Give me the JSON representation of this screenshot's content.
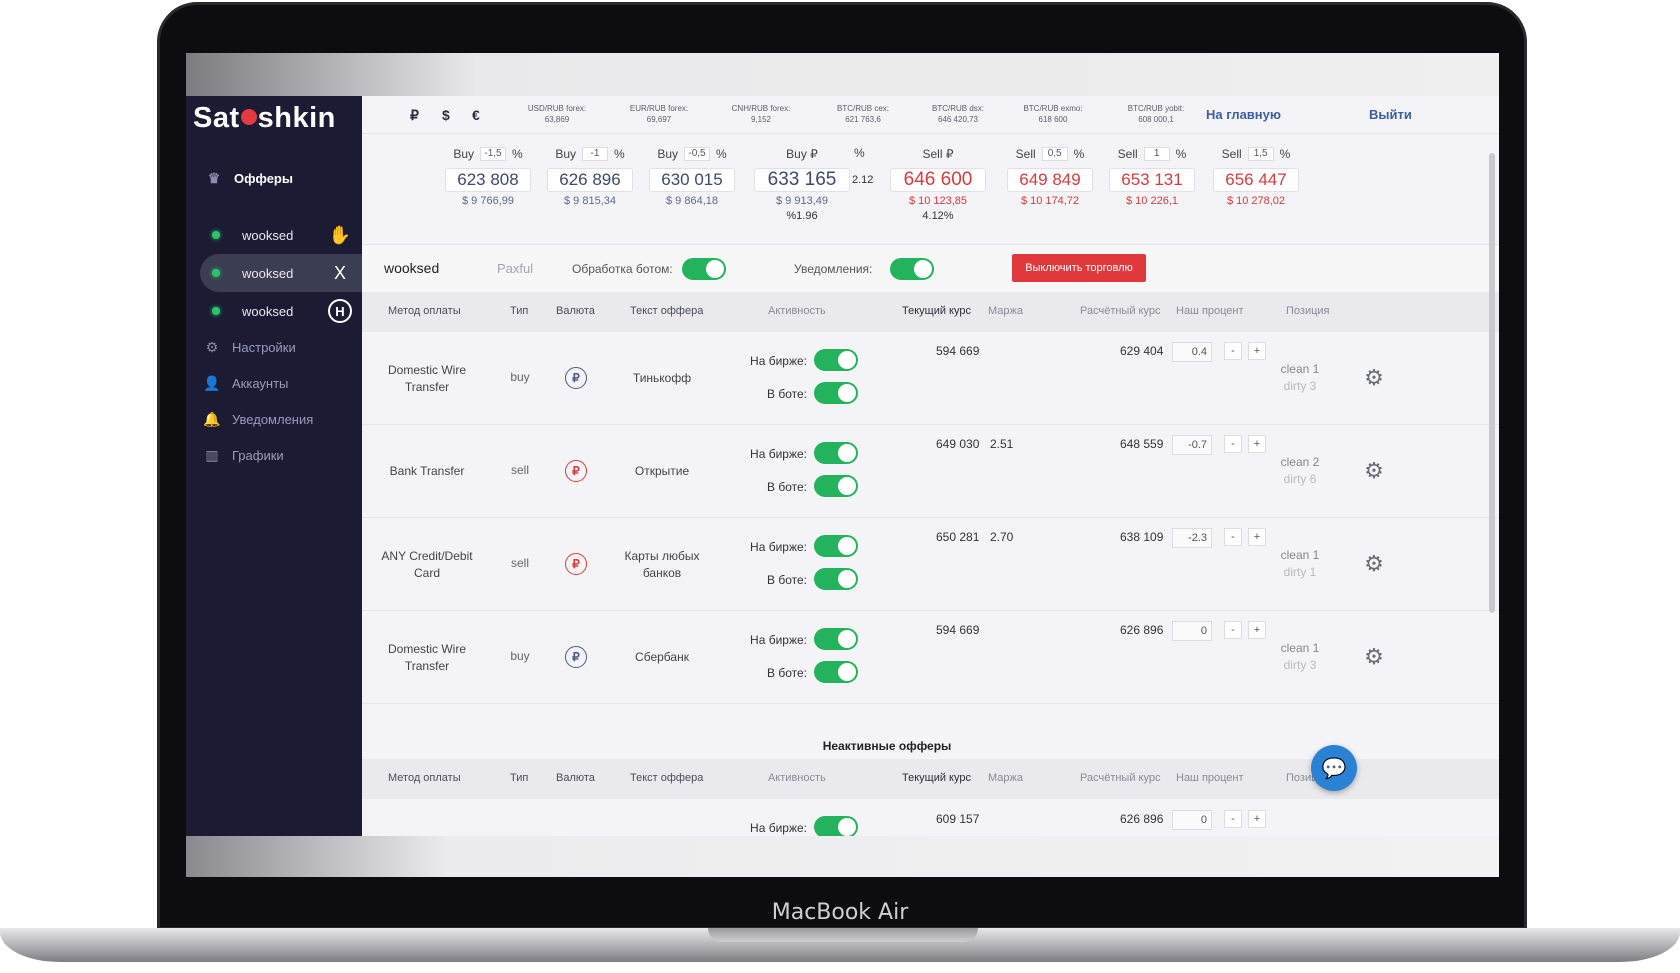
{
  "device": {
    "brand": "MacBook Air"
  },
  "app": {
    "logo_prefix": "Sat",
    "logo_suffix": "shkin"
  },
  "sidebar": {
    "offers_label": "Офферы",
    "accounts": [
      {
        "name": "wooksed",
        "exchange_icon": "hand-icon",
        "exchange_glyph": "✋"
      },
      {
        "name": "wooksed",
        "exchange_icon": "x-exchange-icon",
        "exchange_glyph": "X"
      },
      {
        "name": "wooksed",
        "exchange_icon": "h-exchange-icon",
        "exchange_glyph": "H"
      }
    ],
    "nav": [
      {
        "label": "Настройки",
        "icon": "gear-icon"
      },
      {
        "label": "Аккаунты",
        "icon": "user-icon"
      },
      {
        "label": "Уведомления",
        "icon": "bell-icon"
      },
      {
        "label": "Графики",
        "icon": "chart-icon"
      }
    ]
  },
  "header": {
    "currencies": [
      "₽",
      "$",
      "€"
    ],
    "rates": [
      {
        "label": "USD/RUB forex:",
        "value": "63,869"
      },
      {
        "label": "EUR/RUB forex:",
        "value": "69,697"
      },
      {
        "label": "CNH/RUB forex:",
        "value": "9,152"
      },
      {
        "label": "BTC/RUB cex:",
        "value": "621 763,6"
      },
      {
        "label": "BTC/RUB dsx:",
        "value": "646 420,73"
      },
      {
        "label": "BTC/RUB exmo:",
        "value": "618 600"
      },
      {
        "label": "BTC/RUB yobit:",
        "value": "608 000,1"
      }
    ],
    "home_link": "На главную",
    "logout": "Выйти"
  },
  "prices": [
    {
      "label": "Buy",
      "pct": "-1,5",
      "unit": "%",
      "value": "623 808",
      "usd": "$ 9 766,99",
      "side": "buy"
    },
    {
      "label": "Buy",
      "pct": "-1",
      "unit": "%",
      "value": "626 896",
      "usd": "$ 9 815,34",
      "side": "buy"
    },
    {
      "label": "Buy",
      "pct": "-0,5",
      "unit": "%",
      "value": "630 015",
      "usd": "$ 9 864,18",
      "side": "buy"
    },
    {
      "label": "Buy ₽",
      "pct": "",
      "unit": "",
      "value": "633 165",
      "usd": "$ 9 913,49",
      "sub": "%1.96",
      "side": "buy"
    },
    {
      "label": "Sell ₽",
      "pct": "",
      "unit": "",
      "value": "646 600",
      "usd": "$ 10 123,85",
      "sub": "4.12%",
      "side": "sell"
    },
    {
      "label": "Sell",
      "pct": "0,5",
      "unit": "%",
      "value": "649 849",
      "usd": "$ 10 174,72",
      "side": "sell"
    },
    {
      "label": "Sell",
      "pct": "1",
      "unit": "%",
      "value": "653 131",
      "usd": "$ 10 226,1",
      "side": "sell"
    },
    {
      "label": "Sell",
      "pct": "1,5",
      "unit": "%",
      "value": "656 447",
      "usd": "$ 10 278,02",
      "side": "sell"
    }
  ],
  "spread": {
    "pct_label": "%",
    "value": "2.12"
  },
  "toolbar": {
    "account": "wooksed",
    "tab": "Paxful",
    "bot_label": "Обработка ботом:",
    "notify_label": "Уведомления:",
    "stop_button": "Выключить торговлю"
  },
  "table": {
    "headers": [
      "Метод оплаты",
      "Тип",
      "Валюта",
      "Текст оффера",
      "Активность",
      "Текущий курс",
      "Маржа",
      "Расчётный курс",
      "Наш процент",
      "Позиция"
    ],
    "activity_labels": {
      "exchange": "На бирже:",
      "bot": "В боте:"
    },
    "minus": "-",
    "plus": "+",
    "rows": [
      {
        "method": "Domestic Wire Transfer",
        "type": "buy",
        "currency": "₽",
        "offer": "Тинькофф",
        "current": "594 669",
        "margin": "",
        "calc": "629 404",
        "percent": "0.4",
        "pos_clean": "clean 1",
        "pos_dirty": "dirty 3"
      },
      {
        "method": "Bank Transfer",
        "type": "sell",
        "currency": "₽",
        "offer": "Открытие",
        "current": "649 030",
        "margin": "2.51",
        "calc": "648 559",
        "percent": "-0.7",
        "pos_clean": "clean 2",
        "pos_dirty": "dirty 6"
      },
      {
        "method": "ANY Credit/Debit Card",
        "type": "sell",
        "currency": "₽",
        "offer": "Карты любых банков",
        "current": "650 281",
        "margin": "2.70",
        "calc": "638 109",
        "percent": "-2.3",
        "pos_clean": "clean 1",
        "pos_dirty": "dirty 1"
      },
      {
        "method": "Domestic Wire Transfer",
        "type": "buy",
        "currency": "₽",
        "offer": "Сбербанк",
        "current": "594 669",
        "margin": "",
        "calc": "626 896",
        "percent": "0",
        "pos_clean": "clean 1",
        "pos_dirty": "dirty 3"
      }
    ]
  },
  "inactive": {
    "title": "Неактивные офферы",
    "row": {
      "current": "609 157",
      "calc": "626 896",
      "percent": "0"
    }
  },
  "colors": {
    "sidebar": "#1b1c34",
    "toggle_on": "#22b35c",
    "sell": "#d63c3c",
    "buy": "#3d4a6e",
    "danger": "#e1383c",
    "chat": "#2a82d4"
  }
}
